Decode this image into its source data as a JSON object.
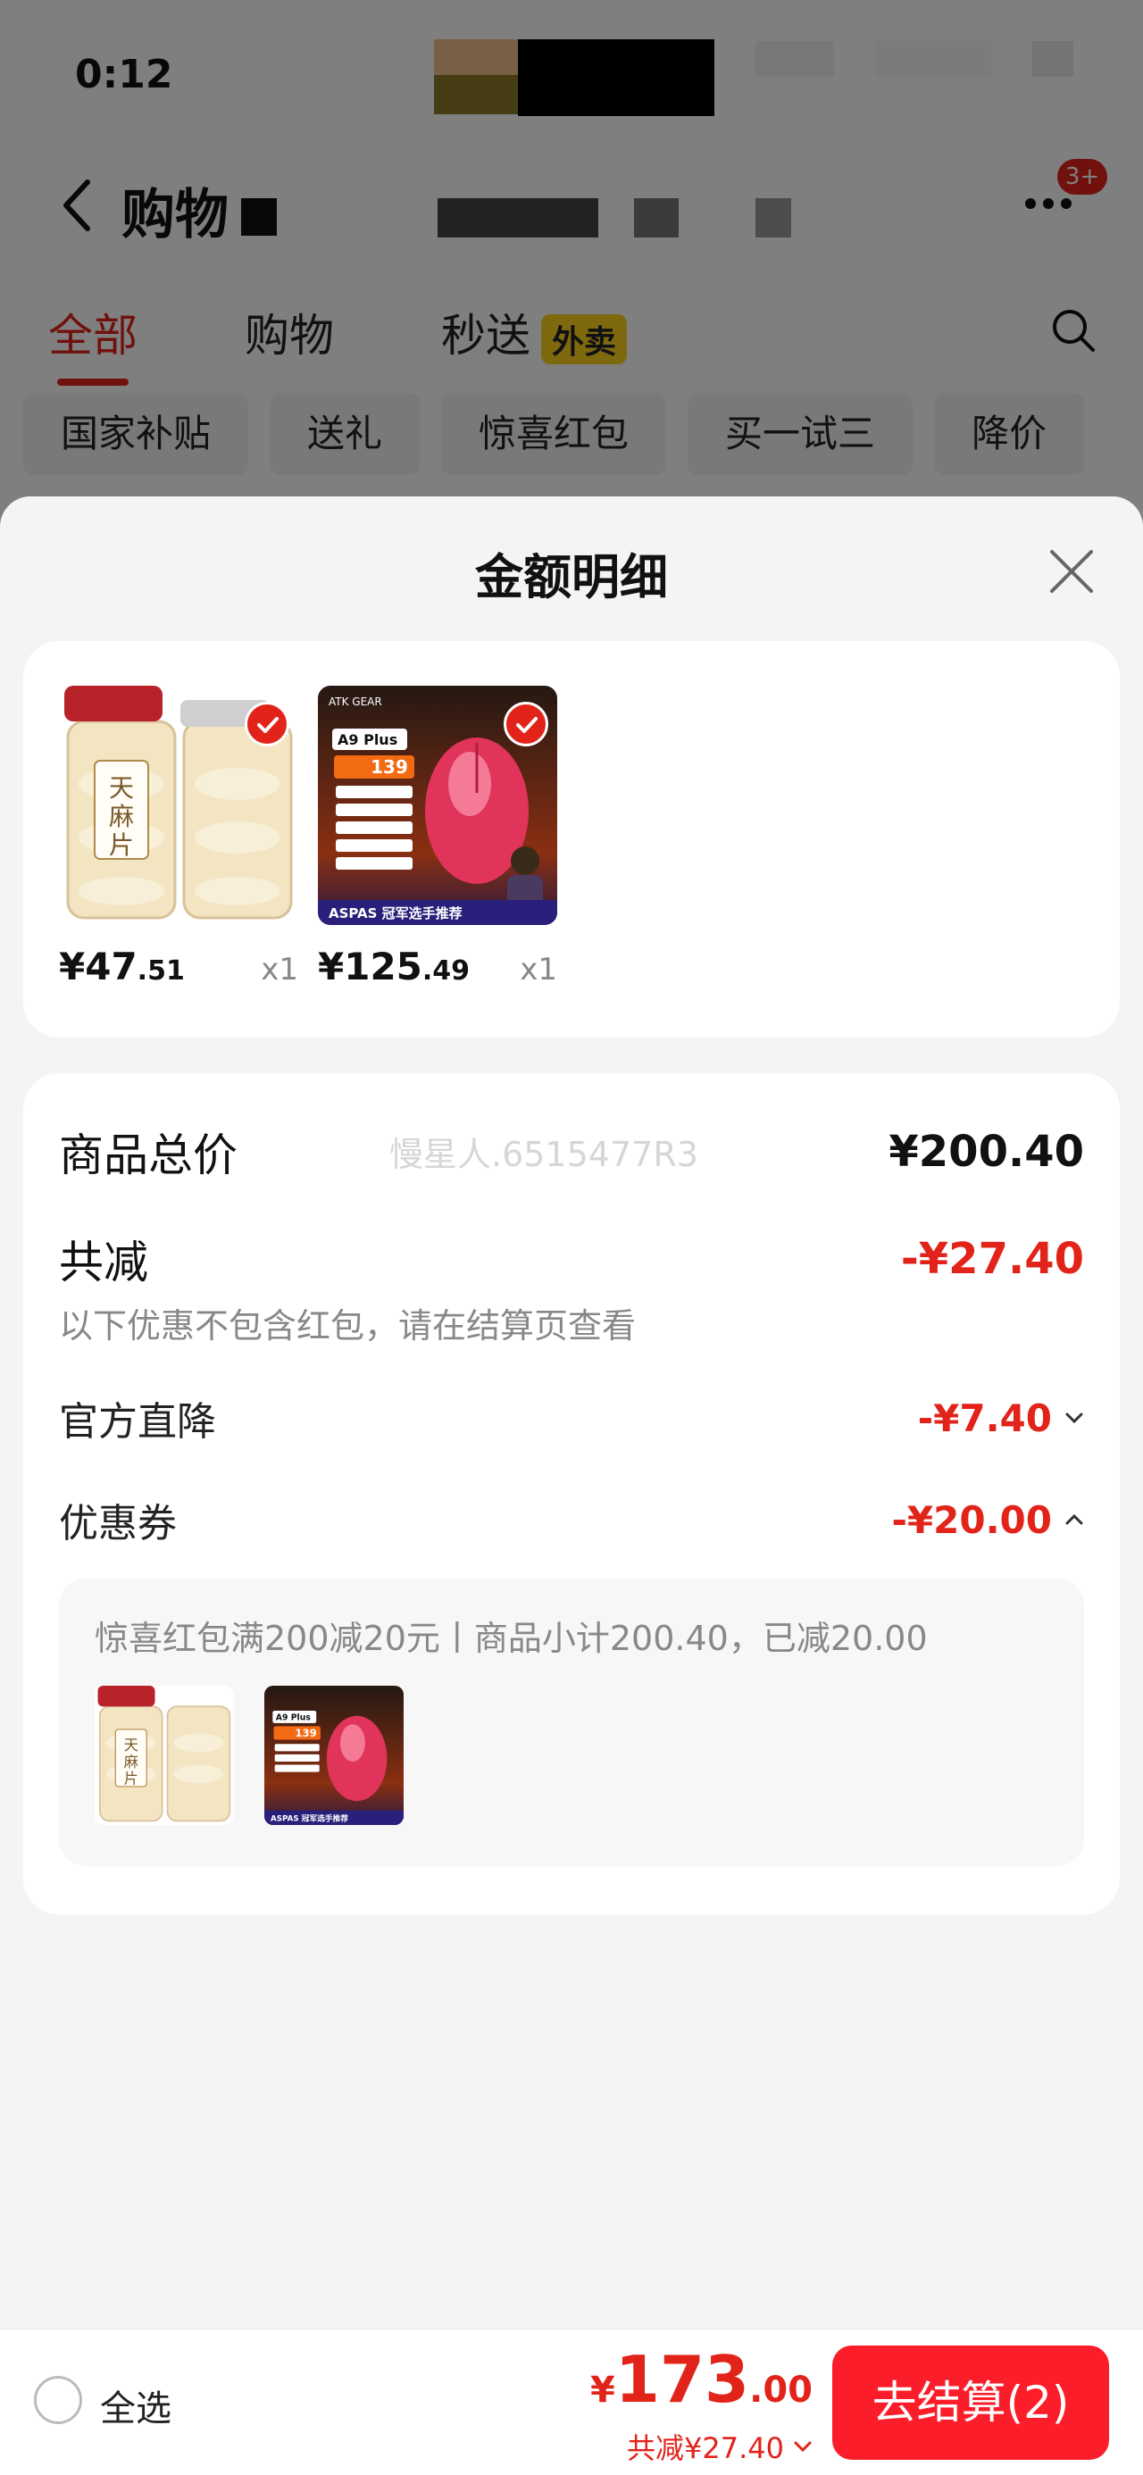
{
  "status_bar": {
    "time": "0:12"
  },
  "header": {
    "title": "购物",
    "cart_badge": "3+"
  },
  "tabs": [
    {
      "label": "全部"
    },
    {
      "label": "购物"
    },
    {
      "label": "秒送",
      "badge": "外卖"
    }
  ],
  "chips": [
    "国家补贴",
    "送礼",
    "惊喜红包",
    "买一试三",
    "降价"
  ],
  "sheet": {
    "title": "金额明细",
    "products": [
      {
        "name": "天麻片",
        "price_int": "¥47",
        "price_dec": ".51",
        "qty": "x1"
      },
      {
        "name": "A9 Plus",
        "price_int": "¥125",
        "price_dec": ".49",
        "qty": "x1"
      }
    ],
    "summary": {
      "total_label": "商品总价",
      "total_value": "¥200.40",
      "watermark": "慢星人.6515477R3",
      "reduce_label": "共减",
      "reduce_value": "-¥27.40",
      "note": "以下优惠不包含红包，请在结算页查看",
      "official_label": "官方直降",
      "official_value": "-¥7.40",
      "coupon_label": "优惠券",
      "coupon_value": "-¥20.00",
      "coupon_detail": "惊喜红包满200减20元丨商品小计200.40，已减20.00"
    }
  },
  "bottom": {
    "select_all": "全选",
    "currency": "¥",
    "total_int": "173",
    "total_dec": ".00",
    "saved": "共减¥27.40",
    "checkout": "去结算(2)"
  },
  "colors": {
    "accent": "#e2231a",
    "checkout": "#fb1e2a",
    "badge": "#ffd21f"
  },
  "product_images": {
    "p1_label": "天麻片",
    "p2_text": {
      "model": "A9 Plus",
      "brand": "ATK GEAR",
      "price": "139",
      "banner": "ASPAS 冠军选手推荐"
    }
  }
}
